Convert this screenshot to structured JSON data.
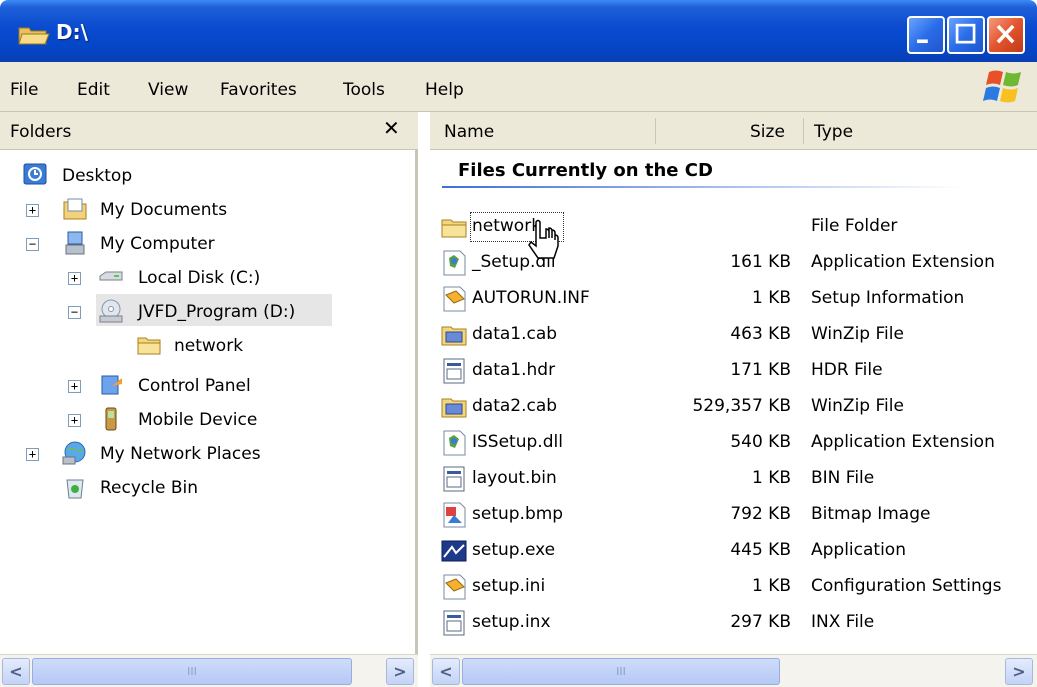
{
  "window": {
    "title": "D:\\"
  },
  "menu": [
    "File",
    "Edit",
    "View",
    "Favorites",
    "Tools",
    "Help"
  ],
  "folders_pane": {
    "header": "Folders",
    "close_glyph": "✕",
    "tree": [
      {
        "label": "Desktop",
        "icon": "desktop-icon"
      },
      {
        "label": "My Documents",
        "icon": "my-documents-icon",
        "expander": "+"
      },
      {
        "label": "My Computer",
        "icon": "my-computer-icon",
        "expander": "−"
      },
      {
        "label": "Local Disk (C:)",
        "icon": "local-disk-icon",
        "expander": "+"
      },
      {
        "label": "JVFD_Program (D:)",
        "icon": "cd-drive-icon",
        "expander": "−",
        "selected": true
      },
      {
        "label": "network",
        "icon": "folder-icon"
      },
      {
        "label": "Control Panel",
        "icon": "control-panel-icon",
        "expander": "+"
      },
      {
        "label": "Mobile Device",
        "icon": "mobile-device-icon",
        "expander": "+"
      },
      {
        "label": "My Network Places",
        "icon": "network-places-icon",
        "expander": "+"
      },
      {
        "label": "Recycle Bin",
        "icon": "recycle-bin-icon"
      }
    ]
  },
  "list": {
    "columns": [
      "Name",
      "Size",
      "Type"
    ],
    "group_title": "Files Currently on the CD",
    "files": [
      {
        "name": "network",
        "size": "",
        "type": "File Folder",
        "icon": "folder-icon"
      },
      {
        "name": "_Setup.dll",
        "size": "161 KB",
        "type": "Application Extension",
        "icon": "dll-icon"
      },
      {
        "name": "AUTORUN.INF",
        "size": "1 KB",
        "type": "Setup Information",
        "icon": "inf-icon"
      },
      {
        "name": "data1.cab",
        "size": "463 KB",
        "type": "WinZip File",
        "icon": "cab-icon"
      },
      {
        "name": "data1.hdr",
        "size": "171 KB",
        "type": "HDR File",
        "icon": "generic-file-icon"
      },
      {
        "name": "data2.cab",
        "size": "529,357 KB",
        "type": "WinZip File",
        "icon": "cab-icon"
      },
      {
        "name": "ISSetup.dll",
        "size": "540 KB",
        "type": "Application Extension",
        "icon": "dll-icon"
      },
      {
        "name": "layout.bin",
        "size": "1 KB",
        "type": "BIN File",
        "icon": "generic-file-icon"
      },
      {
        "name": "setup.bmp",
        "size": "792 KB",
        "type": "Bitmap Image",
        "icon": "bitmap-icon"
      },
      {
        "name": "setup.exe",
        "size": "445 KB",
        "type": "Application",
        "icon": "exe-icon"
      },
      {
        "name": "setup.ini",
        "size": "1 KB",
        "type": "Configuration Settings",
        "icon": "ini-icon"
      },
      {
        "name": "setup.inx",
        "size": "297 KB",
        "type": "INX File",
        "icon": "generic-file-icon"
      }
    ]
  },
  "scroll": {
    "left_arrow": "<",
    "right_arrow": ">",
    "grip": "III"
  }
}
